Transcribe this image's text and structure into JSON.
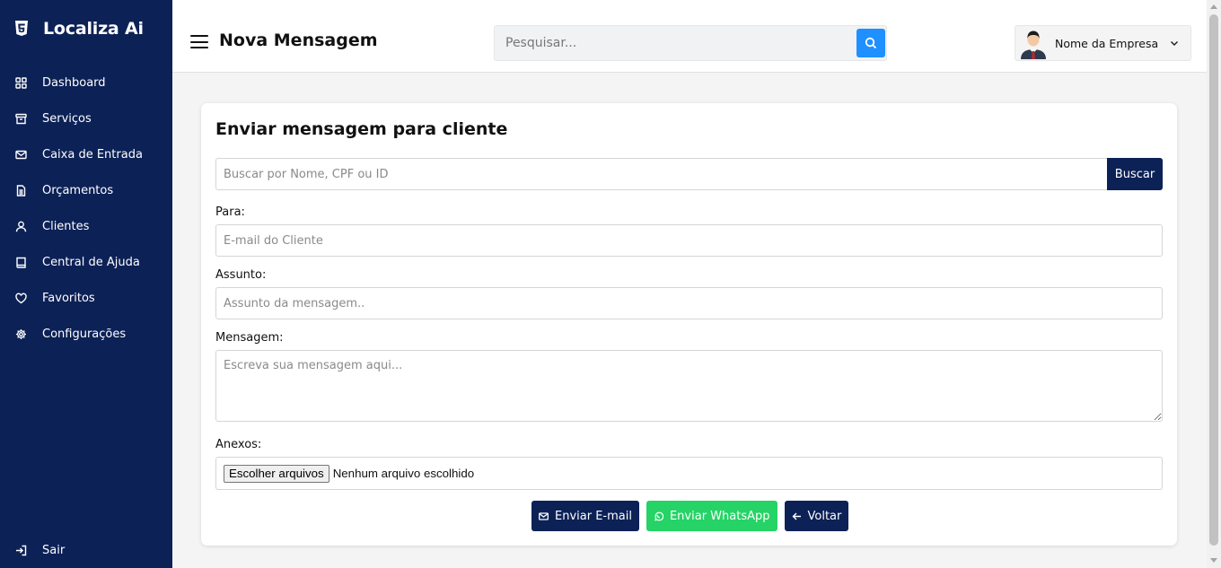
{
  "brand": {
    "name": "Localiza Ai",
    "icon": "html5-icon"
  },
  "sidebar": {
    "items": [
      {
        "label": "Dashboard",
        "icon": "dashboard-icon"
      },
      {
        "label": "Serviços",
        "icon": "archive-icon"
      },
      {
        "label": "Caixa de Entrada",
        "icon": "envelope-icon"
      },
      {
        "label": "Orçamentos",
        "icon": "document-icon"
      },
      {
        "label": "Clientes",
        "icon": "user-icon"
      },
      {
        "label": "Central de Ajuda",
        "icon": "book-icon"
      },
      {
        "label": "Favoritos",
        "icon": "heart-icon"
      },
      {
        "label": "Configurações",
        "icon": "gear-icon"
      }
    ],
    "logout": {
      "label": "Sair",
      "icon": "logout-icon"
    }
  },
  "header": {
    "title": "Nova Mensagem",
    "search_placeholder": "Pesquisar...",
    "profile_name": "Nome da Empresa"
  },
  "form": {
    "title": "Enviar mensagem para cliente",
    "lookup_placeholder": "Buscar por Nome, CPF ou ID",
    "lookup_button": "Buscar",
    "to_label": "Para:",
    "to_placeholder": "E-mail do Cliente",
    "subject_label": "Assunto:",
    "subject_placeholder": "Assunto da mensagem..",
    "message_label": "Mensagem:",
    "message_placeholder": "Escreva sua mensagem aqui...",
    "attachments_label": "Anexos:",
    "file_button": "Escolher arquivos",
    "file_status": "Nenhum arquivo escolhido",
    "send_email": "Enviar E-mail",
    "send_whatsapp": "Enviar WhatsApp",
    "back": "Voltar"
  },
  "colors": {
    "navy": "#0c2156",
    "whatsapp_green": "#25d366",
    "search_blue": "#1e90ff",
    "page_bg": "#f4f4f4"
  }
}
